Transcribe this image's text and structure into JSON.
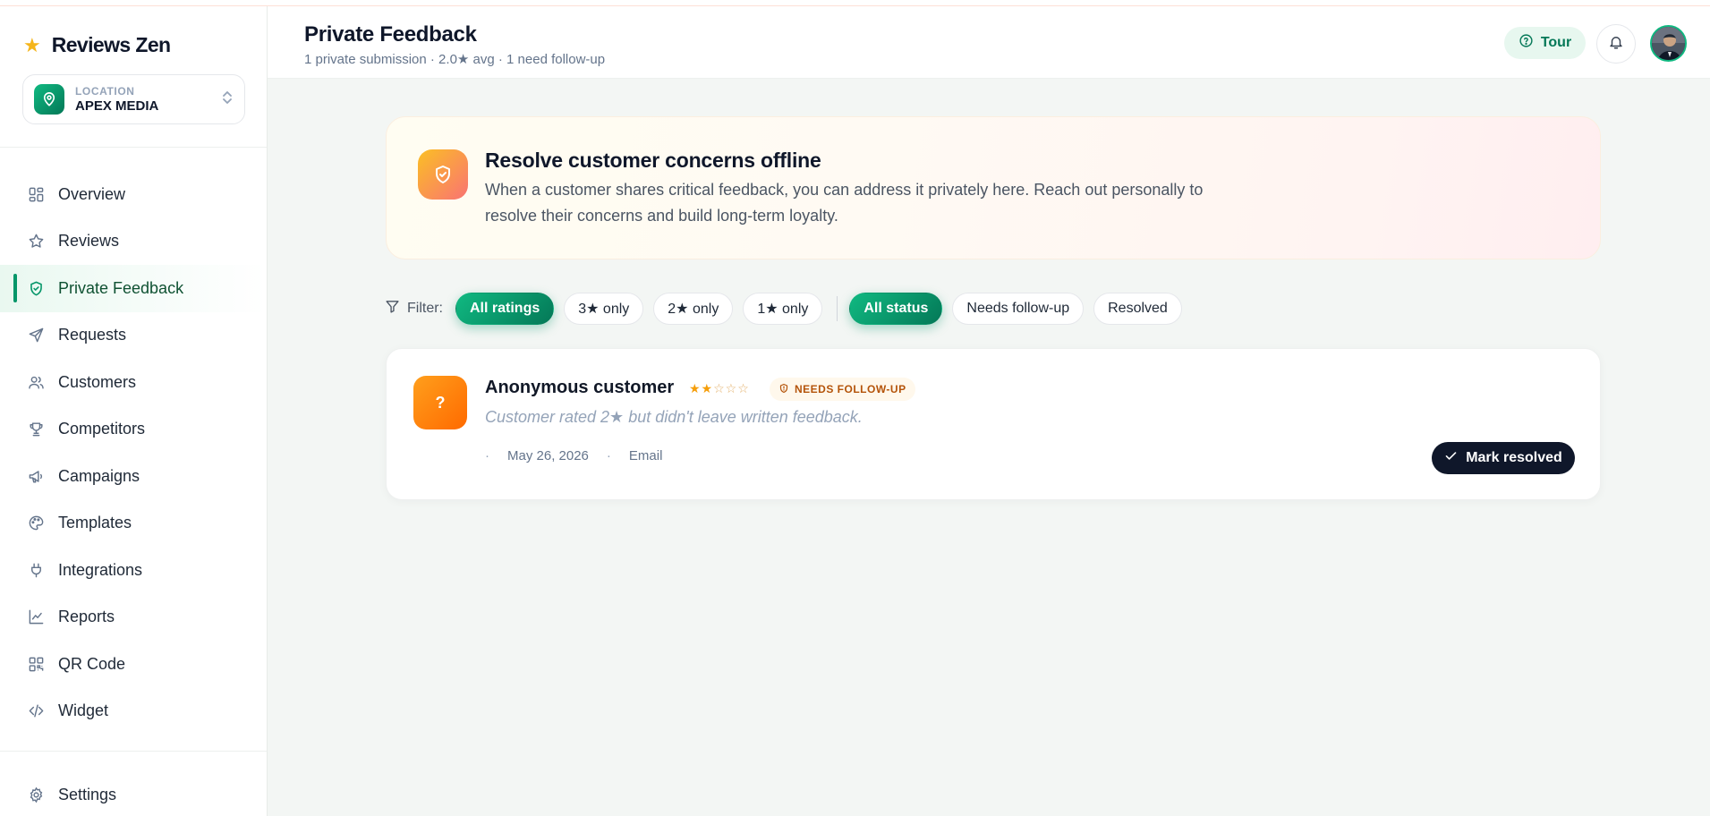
{
  "brand": {
    "name": "Reviews Zen",
    "star_color": "#f5b51b"
  },
  "location": {
    "label": "LOCATION",
    "value": "APEX MEDIA"
  },
  "sidebar": {
    "items": [
      {
        "label": "Overview",
        "icon": "grid-icon"
      },
      {
        "label": "Reviews",
        "icon": "star-icon"
      },
      {
        "label": "Private Feedback",
        "icon": "shield-check-icon",
        "active": true
      },
      {
        "label": "Requests",
        "icon": "send-icon"
      },
      {
        "label": "Customers",
        "icon": "users-icon"
      },
      {
        "label": "Competitors",
        "icon": "trophy-icon"
      },
      {
        "label": "Campaigns",
        "icon": "megaphone-icon"
      },
      {
        "label": "Templates",
        "icon": "palette-icon"
      },
      {
        "label": "Integrations",
        "icon": "plug-icon"
      },
      {
        "label": "Reports",
        "icon": "chart-line-icon"
      },
      {
        "label": "QR Code",
        "icon": "qr-code-icon"
      },
      {
        "label": "Widget",
        "icon": "code-icon"
      }
    ],
    "settings": {
      "label": "Settings",
      "icon": "gear-icon"
    }
  },
  "header": {
    "title": "Private Feedback",
    "subtitle": "1 private submission · 2.0★ avg · 1 need follow-up",
    "tour_label": "Tour"
  },
  "banner": {
    "title": "Resolve customer concerns offline",
    "text": "When a customer shares critical feedback, you can address it privately here. Reach out personally to resolve their concerns and build long-term loyalty."
  },
  "filters": {
    "label": "Filter:",
    "ratings": [
      "All ratings",
      "3★ only",
      "2★ only",
      "1★ only"
    ],
    "statuses": [
      "All status",
      "Needs follow-up",
      "Resolved"
    ],
    "active_rating": "All ratings",
    "active_status": "All status"
  },
  "feedback": [
    {
      "avatar_text": "?",
      "name": "Anonymous customer",
      "rating": 2,
      "stars_filled": "★★",
      "stars_empty": "☆☆☆",
      "status": "NEEDS FOLLOW-UP",
      "quote": "Customer rated 2★ but didn't leave written feedback.",
      "date": "May 26, 2026",
      "channel": "Email",
      "action_label": "Mark resolved"
    }
  ],
  "colors": {
    "accent": "#059669",
    "accent_dark": "#047857",
    "warning": "#b45309",
    "dark_button": "#0f172a"
  }
}
